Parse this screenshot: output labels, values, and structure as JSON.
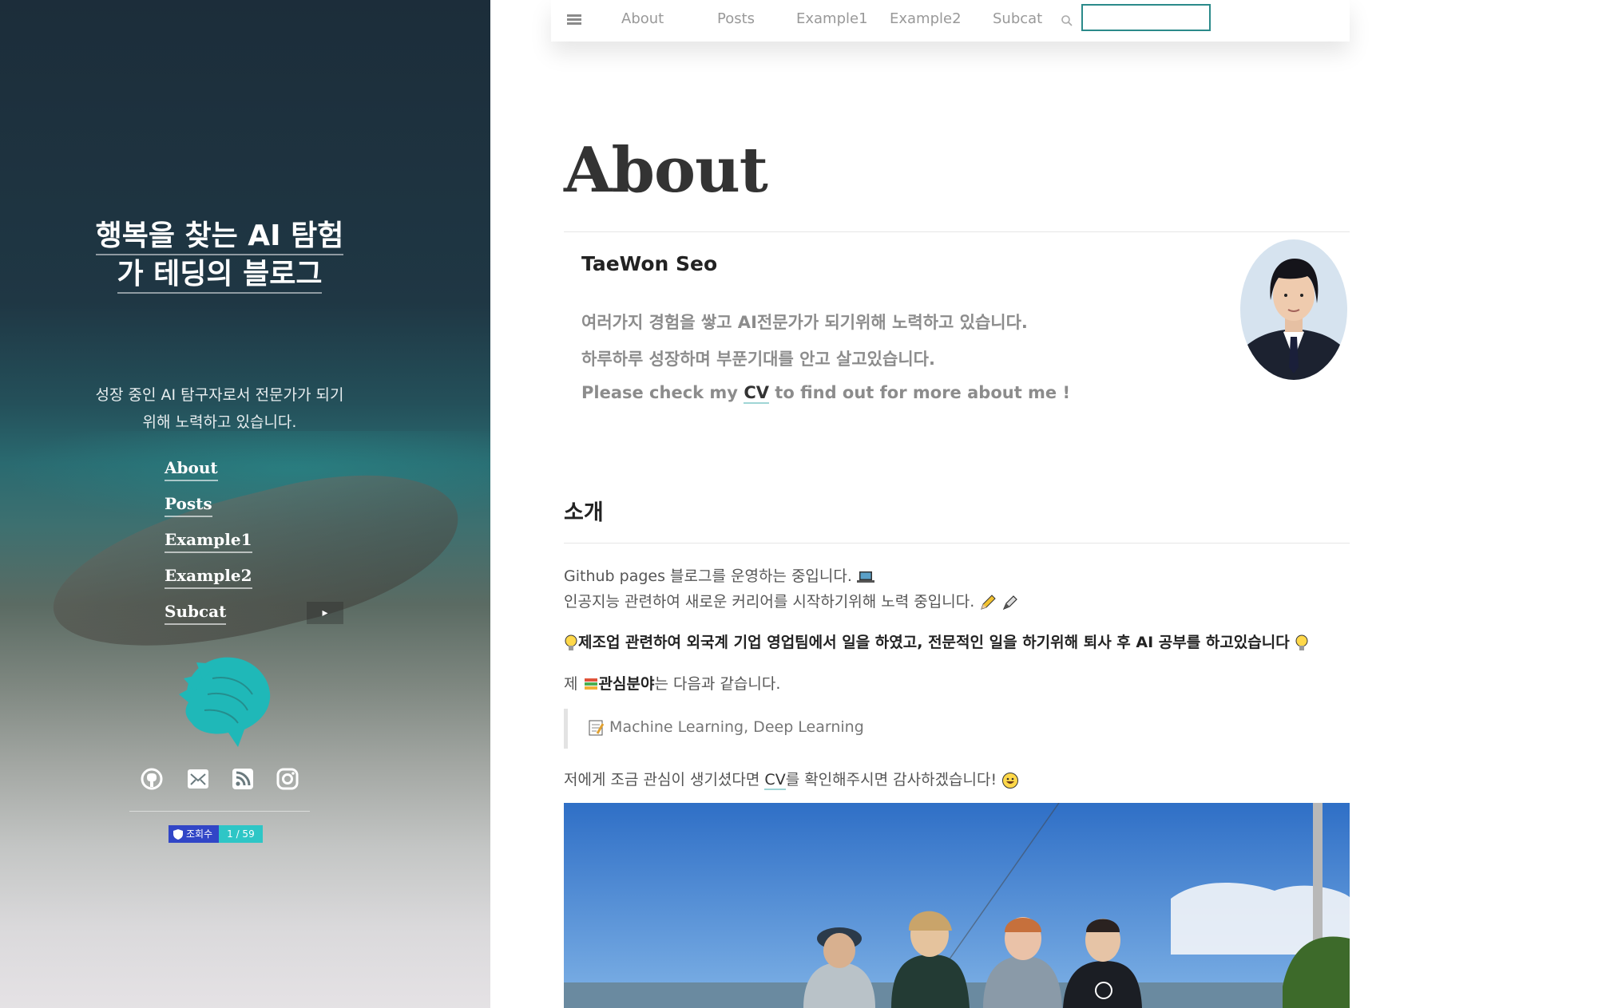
{
  "sidebar": {
    "title_line1": "행복을 찾는 AI 탐험",
    "title_line2": "가 테딩의 블로그",
    "description_line1": "성장 중인 AI 탐구자로서 전문가가 되기",
    "description_line2": "위해 노력하고 있습니다.",
    "nav": [
      "About",
      "Posts",
      "Example1",
      "Example2",
      "Subcat"
    ],
    "subcat_caret": "▸",
    "social_icons": [
      "github-icon",
      "email-icon",
      "rss-icon",
      "instagram-icon"
    ],
    "hits_label": "조회수",
    "hits_value": "1 / 59"
  },
  "topnav": {
    "items": [
      "About",
      "Posts",
      "Example1",
      "Example2",
      "Subcat"
    ],
    "search_value": ""
  },
  "page": {
    "title": "About",
    "author": "TaeWon Seo",
    "intro_line1": "여러가지 경험을 쌓고 AI전문가가 되기위해 노력하고 있습니다.",
    "intro_line2": "하루하루 성장하며 부푼기대를 안고 살고있습니다.",
    "intro_line3_pre": "Please check my",
    "intro_line3_link": "CV",
    "intro_line3_post": "to find out for more about me !",
    "section_title": "소개",
    "p1": "Github pages 블로그를 운영하는 중입니다.",
    "p2": "인공지능 관련하여 새로운 커리어를 시작하기위해 노력 중입니다.",
    "p3": "제조업 관련하여 외국계 기업 영업팀에서 일을 하였고, 전문적인 일을 하기위해 퇴사 후 AI 공부를 하고있습니다",
    "p4_pre": "제",
    "p4_bold": "관심분야",
    "p4_post": "는 다음과 같습니다.",
    "quote": "Machine Learning, Deep Learning",
    "p5_pre": "저에게 조금 관심이 생기셨다면",
    "p5_link": "CV",
    "p5_post": "를 확인해주시면 감사하겠습니다!"
  },
  "colors": {
    "accent_teal": "#2ec6c6",
    "logo_teal": "#1fb8b8",
    "search_border": "#2b8a8a",
    "hits_blue": "#3146c7"
  }
}
